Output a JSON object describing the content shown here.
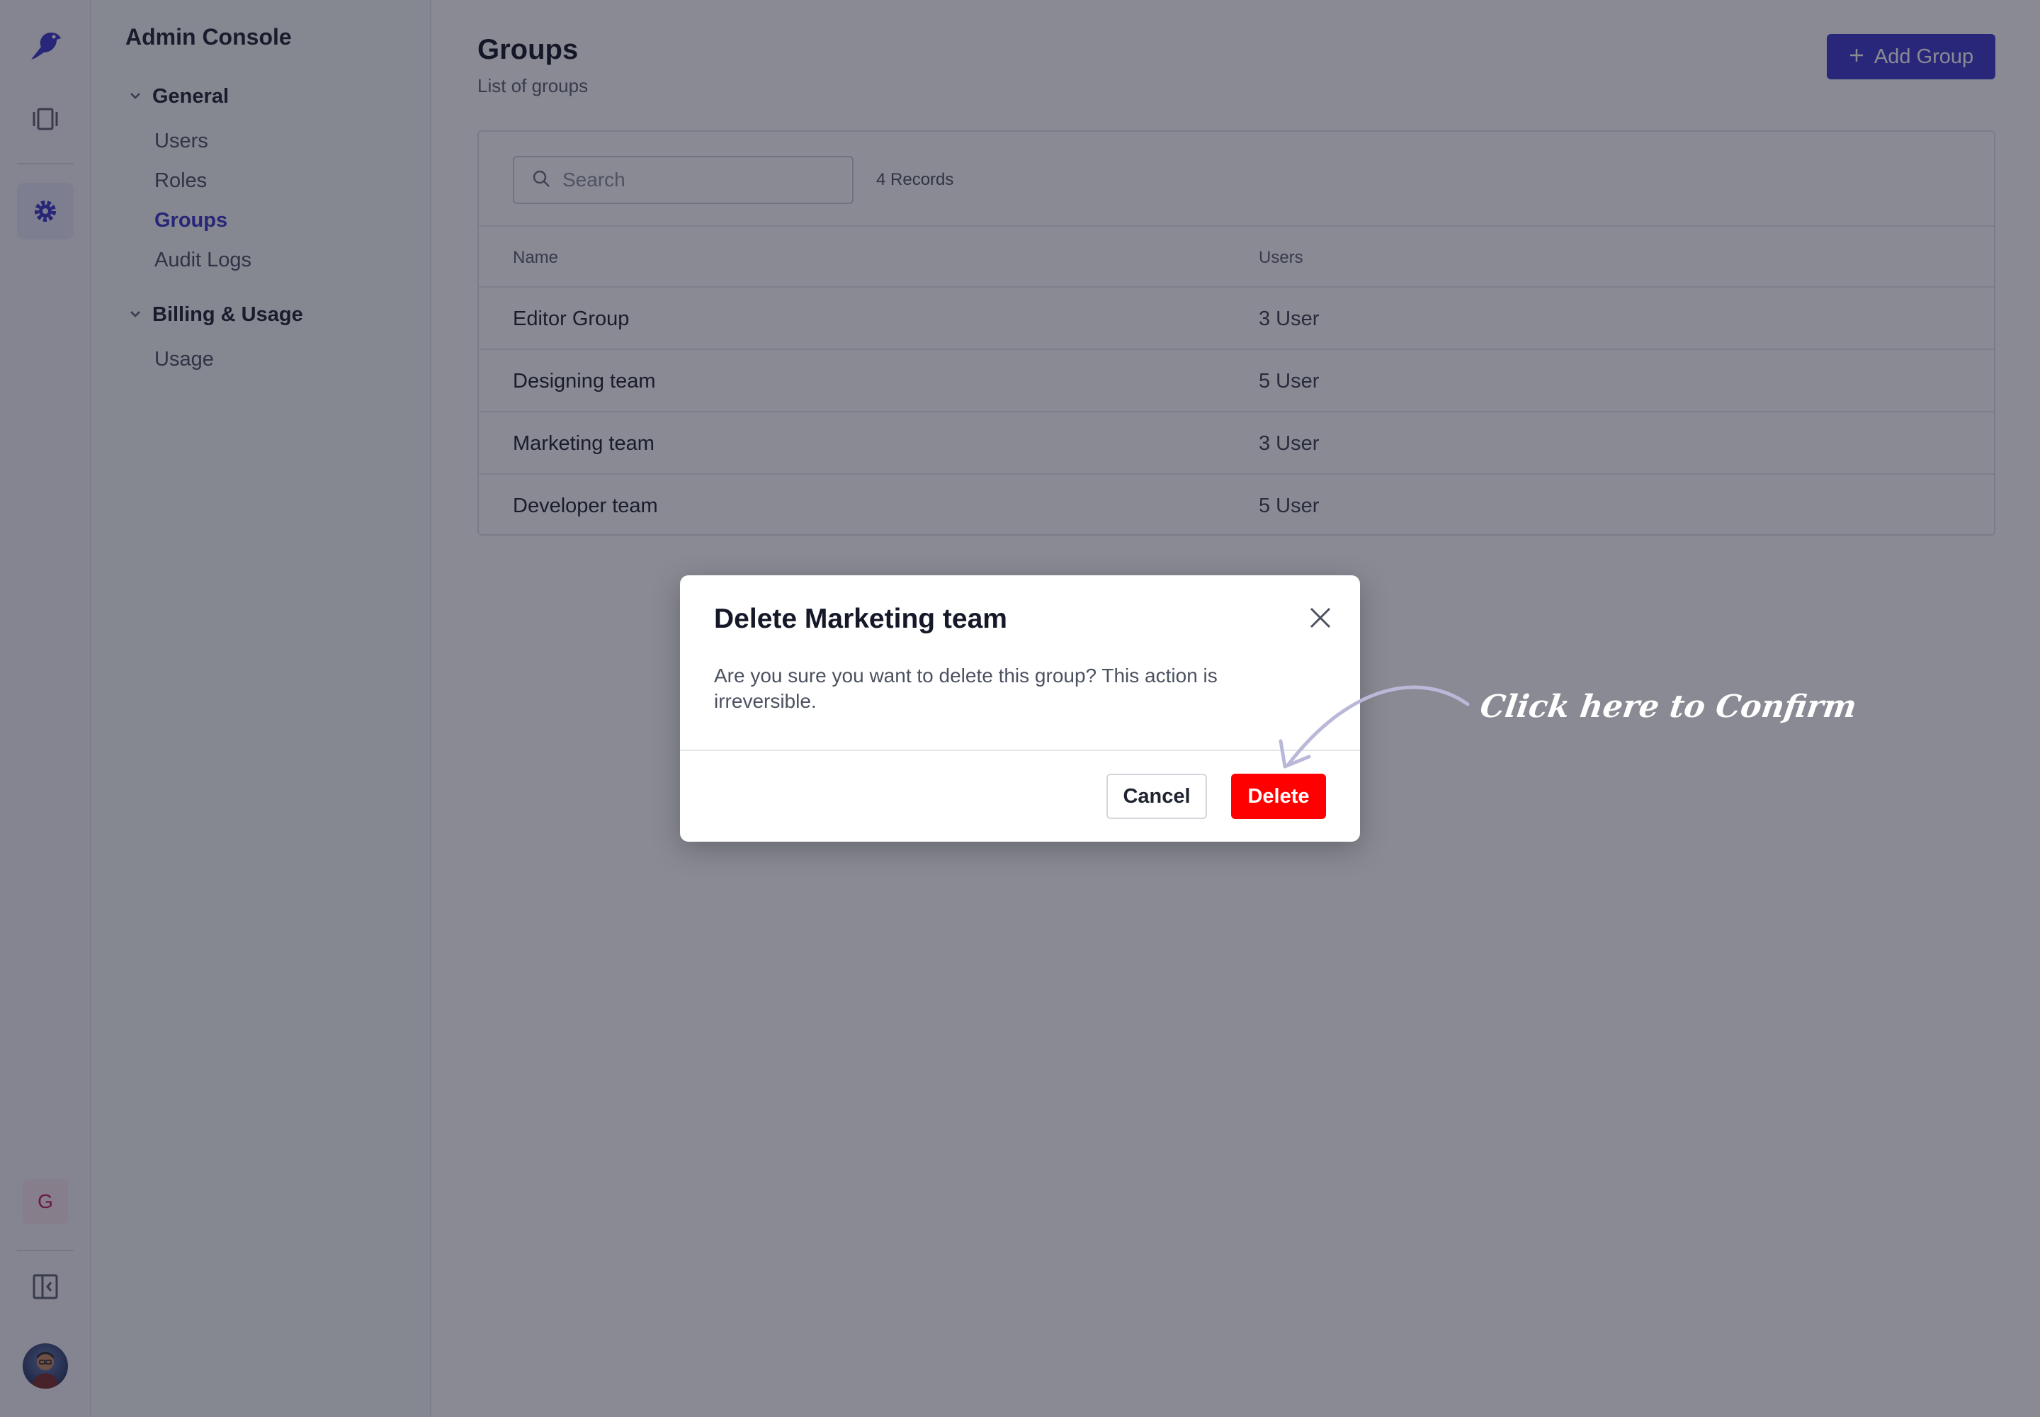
{
  "sidebar": {
    "title": "Admin Console",
    "sections": [
      {
        "label": "General",
        "items": [
          {
            "label": "Users"
          },
          {
            "label": "Roles"
          },
          {
            "label": "Groups",
            "active": true
          },
          {
            "label": "Audit Logs"
          }
        ]
      },
      {
        "label": "Billing & Usage",
        "items": [
          {
            "label": "Usage"
          }
        ]
      }
    ]
  },
  "rail": {
    "icons": [
      "bird-logo-icon",
      "panels-icon",
      "gear-icon"
    ],
    "workspace_badge": "G",
    "bottom_icons": [
      "collapse-sidebar-icon",
      "user-avatar"
    ]
  },
  "page": {
    "title": "Groups",
    "subtitle": "List of groups",
    "add_button": "Add Group"
  },
  "search": {
    "placeholder": "Search",
    "value": ""
  },
  "records_label": "4 Records",
  "table": {
    "columns": [
      "Name",
      "Users"
    ],
    "rows": [
      {
        "name": "Editor Group",
        "users": "3 User"
      },
      {
        "name": "Designing team",
        "users": "5 User"
      },
      {
        "name": "Marketing team",
        "users": "3 User"
      },
      {
        "name": "Developer team",
        "users": "5 User"
      }
    ]
  },
  "modal": {
    "title": "Delete Marketing team",
    "body": "Are you sure you want to delete this group? This action is irreversible.",
    "cancel_label": "Cancel",
    "delete_label": "Delete"
  },
  "annotation": {
    "text": "Click here to Confirm"
  },
  "colors": {
    "accent": "#3d38cc",
    "danger": "#ff0000",
    "overlay": "rgba(20,22,40,0.5)"
  }
}
